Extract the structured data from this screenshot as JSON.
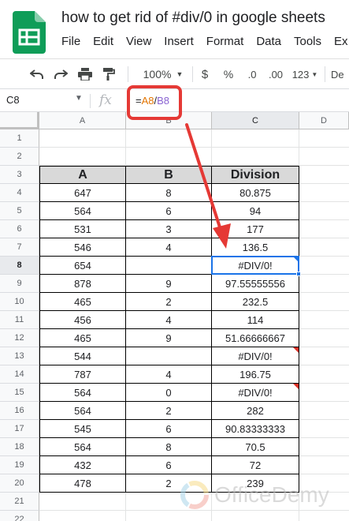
{
  "doc": {
    "title": "how to get rid of #div/0 in google sheets"
  },
  "menu": [
    "File",
    "Edit",
    "View",
    "Insert",
    "Format",
    "Data",
    "Tools",
    "Ex"
  ],
  "toolbar": {
    "zoom": "100%",
    "currency": "$",
    "percent": "%",
    "dec_decrease": ".0",
    "dec_increase": ".00",
    "more_formats": "123",
    "font": "De"
  },
  "formula_bar": {
    "cell_ref": "C8",
    "fx": "fx",
    "formula": {
      "eq": "=",
      "ref1": "A8",
      "slash": "/",
      "ref2": "B8"
    }
  },
  "columns": [
    "A",
    "B",
    "C",
    "D"
  ],
  "rows": [
    "1",
    "2",
    "3",
    "4",
    "5",
    "6",
    "7",
    "8",
    "9",
    "10",
    "11",
    "12",
    "13",
    "14",
    "15",
    "16",
    "17",
    "18",
    "19",
    "20",
    "21",
    "22"
  ],
  "table": {
    "headers": [
      "A",
      "B",
      "Division"
    ],
    "rows": [
      [
        "647",
        "8",
        "80.875"
      ],
      [
        "564",
        "6",
        "94"
      ],
      [
        "531",
        "3",
        "177"
      ],
      [
        "546",
        "4",
        "136.5"
      ],
      [
        "654",
        "",
        "#DIV/0!"
      ],
      [
        "878",
        "9",
        "97.55555556"
      ],
      [
        "465",
        "2",
        "232.5"
      ],
      [
        "456",
        "4",
        "114"
      ],
      [
        "465",
        "9",
        "51.66666667"
      ],
      [
        "544",
        "",
        "#DIV/0!"
      ],
      [
        "787",
        "4",
        "196.75"
      ],
      [
        "564",
        "0",
        "#DIV/0!"
      ],
      [
        "564",
        "2",
        "282"
      ],
      [
        "545",
        "6",
        "90.83333333"
      ],
      [
        "564",
        "8",
        "70.5"
      ],
      [
        "432",
        "6",
        "72"
      ],
      [
        "478",
        "2",
        "239"
      ]
    ]
  },
  "watermark": "OfficeDemy",
  "colors": {
    "highlight": "#e53935",
    "selection": "#1a73e8",
    "header_fill": "#d9d9d9",
    "logo_green": "#0f9d58"
  }
}
